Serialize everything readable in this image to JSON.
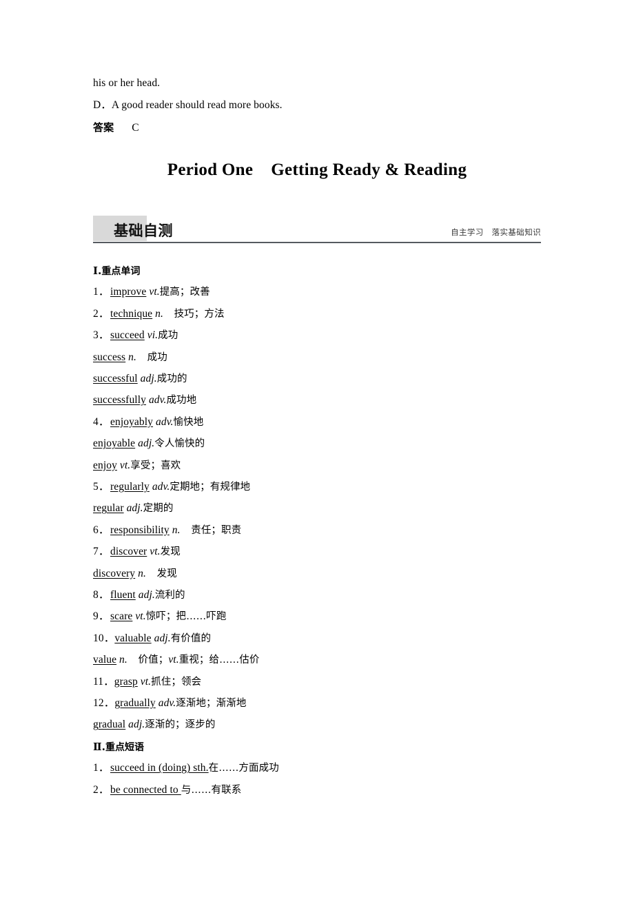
{
  "page": {
    "background": "#ffffff",
    "accent_gray": "#d9d9d9",
    "rule_color": "#555a60"
  },
  "top_block": {
    "continued_line": "his or her head.",
    "option_d": "D．A good reader should read more books.",
    "answer_label": "答案",
    "answer_value": "C"
  },
  "period_title": {
    "period": "Period One",
    "subject": "Getting Ready & Reading"
  },
  "section_header": {
    "title": "基础自测",
    "caption": "自主学习　落实基础知识"
  },
  "sections": [
    {
      "heading_numeral": "Ⅰ",
      "heading_text": ".重点单词",
      "entries": [
        {
          "num": "1．",
          "word": "improve",
          "pos": "vt.",
          "pos_sep": "",
          "meaning": "提高；改善"
        },
        {
          "num": "2．",
          "word": "technique",
          "pos": "n.",
          "pos_sep": "　",
          "meaning": "技巧；方法"
        },
        {
          "num": "3．",
          "word": "succeed",
          "pos": "vi.",
          "pos_sep": "",
          "meaning": "成功"
        },
        {
          "num": "",
          "word": "success",
          "pos": "n.",
          "pos_sep": "　",
          "meaning": "成功"
        },
        {
          "num": "",
          "word": "successful",
          "pos": "adj.",
          "pos_sep": "",
          "meaning": "成功的"
        },
        {
          "num": "",
          "word": "successfully",
          "pos": "adv.",
          "pos_sep": "",
          "meaning": "成功地"
        },
        {
          "num": "4．",
          "word": "enjoyably",
          "pos": "adv.",
          "pos_sep": "",
          "meaning": "愉快地"
        },
        {
          "num": "",
          "word": "enjoyable",
          "pos": "adj.",
          "pos_sep": "",
          "meaning": "令人愉快的"
        },
        {
          "num": "",
          "word": "enjoy",
          "pos": "vt.",
          "pos_sep": "",
          "meaning": "享受；喜欢"
        },
        {
          "num": "5．",
          "word": "regularly",
          "pos": "adv.",
          "pos_sep": "",
          "meaning": "定期地；有规律地"
        },
        {
          "num": "",
          "word": "regular",
          "pos": "adj.",
          "pos_sep": "",
          "meaning": "定期的"
        },
        {
          "num": "6．",
          "word": "responsibility",
          "pos": "n.",
          "pos_sep": "　",
          "meaning": "责任；职责"
        },
        {
          "num": "7．",
          "word": "discover",
          "pos": "vt.",
          "pos_sep": "",
          "meaning": "发现"
        },
        {
          "num": "",
          "word": "discovery",
          "pos": "n.",
          "pos_sep": "　",
          "meaning": "发现"
        },
        {
          "num": "8．",
          "word": "fluent",
          "pos": "adj.",
          "pos_sep": "",
          "meaning": "流利的"
        },
        {
          "num": "9．",
          "word": "scare",
          "pos": "vt.",
          "pos_sep": "",
          "meaning": "惊吓；把……吓跑"
        },
        {
          "num": "10．",
          "word": "valuable",
          "pos": "adj.",
          "pos_sep": "",
          "meaning": "有价值的"
        },
        {
          "num": "",
          "word": "value",
          "pos": "n.",
          "pos_sep": "　",
          "meaning": "价值；",
          "meaning2_pos": "vt.",
          "meaning2": "重视；给……估价"
        },
        {
          "num": "11．",
          "word": "grasp",
          "pos": "vt.",
          "pos_sep": "",
          "meaning": "抓住；领会"
        },
        {
          "num": "12．",
          "word": "gradually",
          "pos": "adv.",
          "pos_sep": "",
          "meaning": "逐渐地；渐渐地"
        },
        {
          "num": "",
          "word": "gradual",
          "pos": "adj.",
          "pos_sep": "",
          "meaning": "逐渐的；逐步的"
        }
      ]
    },
    {
      "heading_numeral": "Ⅱ",
      "heading_text": ".重点短语",
      "entries": [
        {
          "num": "1．",
          "word": "succeed in (doing) sth.",
          "pos": "",
          "pos_sep": "",
          "meaning": "在……方面成功"
        },
        {
          "num": "2．",
          "word": "be connected to ",
          "pos": "",
          "pos_sep": "",
          "meaning": "与……有联系"
        }
      ]
    }
  ]
}
